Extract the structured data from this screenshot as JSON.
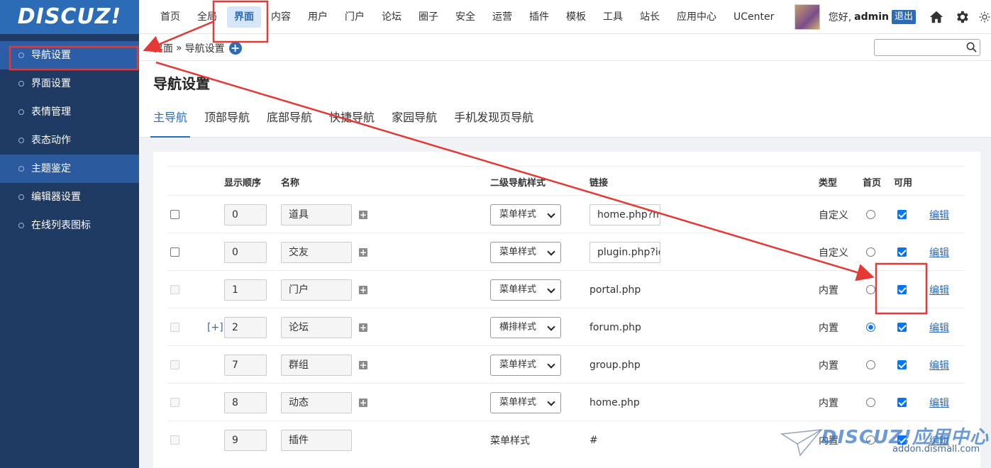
{
  "app": {
    "logo": "DISCUZ!"
  },
  "topnav": [
    {
      "label": "首页",
      "active": false
    },
    {
      "label": "全局",
      "active": false
    },
    {
      "label": "界面",
      "active": true
    },
    {
      "label": "内容",
      "active": false
    },
    {
      "label": "用户",
      "active": false
    },
    {
      "label": "门户",
      "active": false
    },
    {
      "label": "论坛",
      "active": false
    },
    {
      "label": "圈子",
      "active": false
    },
    {
      "label": "安全",
      "active": false
    },
    {
      "label": "运营",
      "active": false
    },
    {
      "label": "插件",
      "active": false
    },
    {
      "label": "模板",
      "active": false
    },
    {
      "label": "工具",
      "active": false
    },
    {
      "label": "站长",
      "active": false
    },
    {
      "label": "应用中心",
      "active": false
    },
    {
      "label": "UCenter",
      "active": false
    }
  ],
  "user": {
    "greeting": "您好,",
    "name": "admin",
    "logout": "退出"
  },
  "sidebar": {
    "items": [
      {
        "label": "导航设置",
        "state": "active"
      },
      {
        "label": "界面设置",
        "state": ""
      },
      {
        "label": "表情管理",
        "state": ""
      },
      {
        "label": "表态动作",
        "state": ""
      },
      {
        "label": "主题鉴定",
        "state": "hl"
      },
      {
        "label": "编辑器设置",
        "state": ""
      },
      {
        "label": "在线列表图标",
        "state": ""
      }
    ]
  },
  "breadcrumb": {
    "section": "界面",
    "sep": "»",
    "page": "导航设置",
    "add": "+"
  },
  "search": {
    "value": ""
  },
  "page": {
    "title": "导航设置"
  },
  "tabs": [
    {
      "label": "主导航",
      "active": true
    },
    {
      "label": "顶部导航",
      "active": false
    },
    {
      "label": "底部导航",
      "active": false
    },
    {
      "label": "快捷导航",
      "active": false
    },
    {
      "label": "家园导航",
      "active": false
    },
    {
      "label": "手机发现页导航",
      "active": false
    }
  ],
  "table": {
    "headers": {
      "order": "显示顺序",
      "name": "名称",
      "substyle": "二级导航样式",
      "link": "链接",
      "type": "类型",
      "home": "首页",
      "enabled": "可用"
    },
    "add_sub_icon": "+",
    "edit_label": "编辑",
    "rows": [
      {
        "deletable": true,
        "expand": "",
        "order": "0",
        "name": "道具",
        "addsub": true,
        "style": "菜单样式",
        "style_select": true,
        "link": "home.php?m",
        "link_input": true,
        "type": "自定义",
        "home": false,
        "enabled": true
      },
      {
        "deletable": true,
        "expand": "",
        "order": "0",
        "name": "交友",
        "addsub": true,
        "style": "菜单样式",
        "style_select": true,
        "link": "plugin.php?id",
        "link_input": true,
        "type": "自定义",
        "home": false,
        "enabled": true
      },
      {
        "deletable": false,
        "expand": "",
        "order": "1",
        "name": "门户",
        "addsub": true,
        "style": "菜单样式",
        "style_select": true,
        "link": "portal.php",
        "link_input": false,
        "type": "内置",
        "home": false,
        "enabled": true
      },
      {
        "deletable": false,
        "expand": "[+]",
        "order": "2",
        "name": "论坛",
        "addsub": true,
        "style": "横排样式",
        "style_select": true,
        "link": "forum.php",
        "link_input": false,
        "type": "内置",
        "home": true,
        "enabled": true
      },
      {
        "deletable": false,
        "expand": "",
        "order": "7",
        "name": "群组",
        "addsub": true,
        "style": "菜单样式",
        "style_select": true,
        "link": "group.php",
        "link_input": false,
        "type": "内置",
        "home": false,
        "enabled": true
      },
      {
        "deletable": false,
        "expand": "",
        "order": "8",
        "name": "动态",
        "addsub": true,
        "style": "菜单样式",
        "style_select": true,
        "link": "home.php",
        "link_input": false,
        "type": "内置",
        "home": false,
        "enabled": true
      },
      {
        "deletable": false,
        "expand": "",
        "order": "9",
        "name": "插件",
        "addsub": false,
        "style": "菜单样式",
        "style_select": false,
        "link": "#",
        "link_input": false,
        "type": "内置",
        "home": false,
        "enabled": true
      }
    ]
  },
  "watermark": {
    "brand": "DISCUZ!应用中心",
    "url": "addon.dismall.com"
  },
  "colors": {
    "accent": "#2c6bb6",
    "sidebar": "#1f3a63",
    "annotation": "#e53935"
  }
}
